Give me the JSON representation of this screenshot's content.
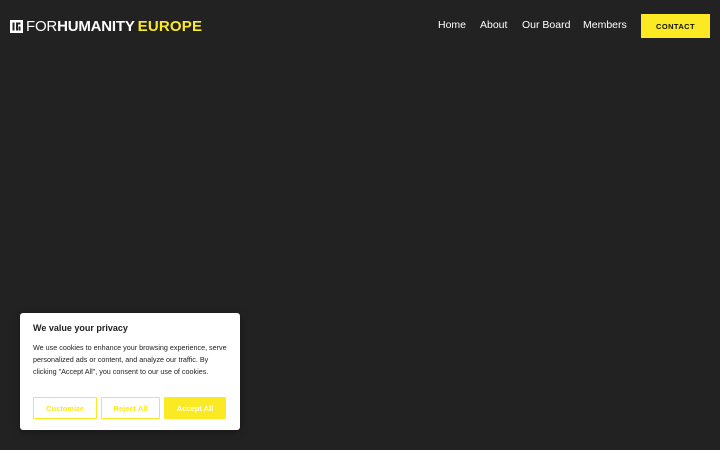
{
  "colors": {
    "background": "#222222",
    "accent": "#fbe923",
    "text": "#ffffff",
    "banner_bg": "#ffffff"
  },
  "header": {
    "logo": {
      "icon": "forhumanity-logo-icon",
      "part_for": "FOR",
      "part_humanity": "HUMANITY",
      "part_europe": "EUROPE"
    },
    "nav": {
      "items": [
        {
          "label": "Home"
        },
        {
          "label": "About"
        },
        {
          "label": "Our Board"
        },
        {
          "label": "Members"
        }
      ]
    },
    "contact_label": "CONTACT"
  },
  "cookie_banner": {
    "title": "We value your privacy",
    "text": "We use cookies to enhance your browsing experience, serve personalized ads or content, and analyze our traffic. By clicking \"Accept All\", you consent to our use of cookies.",
    "customize_label": "Customize",
    "reject_label": "Reject All",
    "accept_label": "Accept All"
  }
}
